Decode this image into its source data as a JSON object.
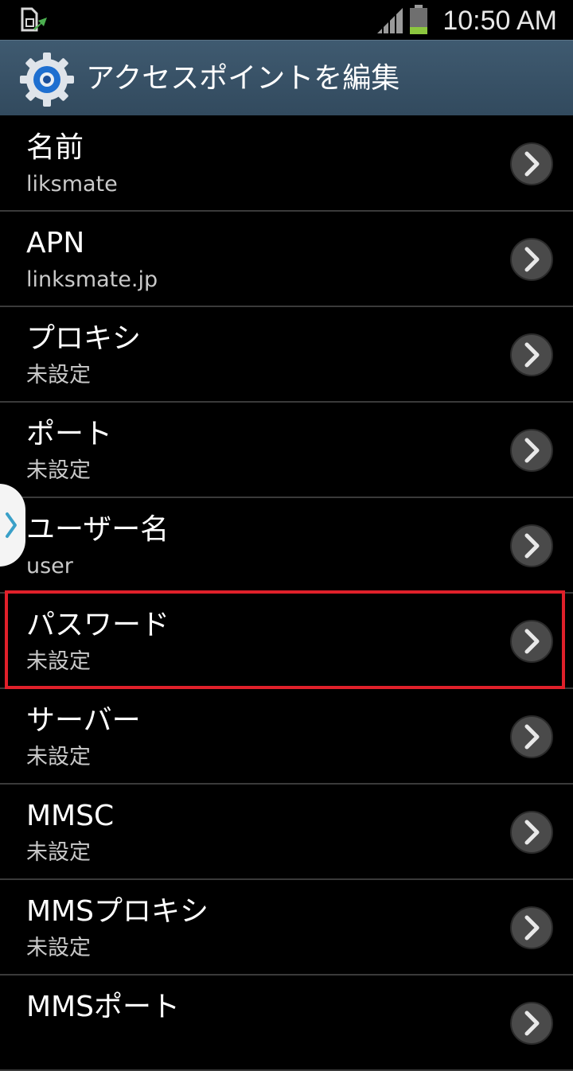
{
  "status_bar": {
    "time": "10:50 AM",
    "icons": [
      "sim-sync-icon",
      "signal-icon",
      "battery-icon"
    ]
  },
  "action_bar": {
    "icon": "settings-gear-icon",
    "title": "アクセスポイントを編集"
  },
  "colors": {
    "action_bar": "#3a5266",
    "highlight": "#e0202a",
    "divider": "#3a3a3a",
    "battery": "#8cc63f"
  },
  "settings": {
    "items": [
      {
        "label": "名前",
        "value": "liksmate"
      },
      {
        "label": "APN",
        "value": "linksmate.jp"
      },
      {
        "label": "プロキシ",
        "value": "未設定"
      },
      {
        "label": "ポート",
        "value": "未設定"
      },
      {
        "label": "ユーザー名",
        "value": "user"
      },
      {
        "label": "パスワード",
        "value": "未設定"
      },
      {
        "label": "サーバー",
        "value": "未設定"
      },
      {
        "label": "MMSC",
        "value": "未設定"
      },
      {
        "label": "MMSプロキシ",
        "value": "未設定"
      },
      {
        "label": "MMSポート",
        "value": ""
      }
    ]
  }
}
